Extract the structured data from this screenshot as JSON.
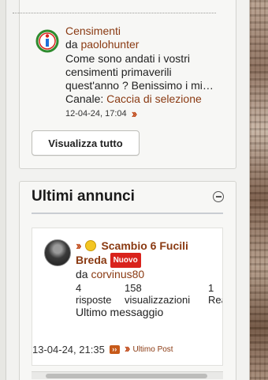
{
  "recent_posts": {
    "item": {
      "title": "Censimenti",
      "by_prefix": "da",
      "author": "paolohunter",
      "excerpt_line1": "Come sono andati i vostri",
      "excerpt_line2": "censimenti primaverili",
      "excerpt_line3": "quest'anno ? Benissimo i mi…",
      "channel_prefix": "Canale:",
      "channel": "Caccia di selezione",
      "timestamp": "12-04-24, 17:04"
    },
    "view_all_label": "Visualizza tutto"
  },
  "ads": {
    "title": "Ultimi annunci",
    "item": {
      "title_line1": "Scambio 6 Fucili",
      "title_line2": "Breda",
      "badge": "Nuovo",
      "by_prefix": "da",
      "author": "corvinus80",
      "replies_count": "4",
      "replies_label": "risposte",
      "views_count": "158",
      "views_label": "visualizzazioni",
      "third_count": "1",
      "third_label": "Rea",
      "last_message_label": "Ultimo messaggio",
      "last_timestamp": "13-04-24, 21:35",
      "last_post_label": "Ultimo Post"
    }
  },
  "colors": {
    "link": "#8a3a12",
    "accent_orange": "#c04a1a",
    "badge_red": "#d9231d"
  },
  "icons": [
    "census-logo-icon",
    "double-chevron-icon",
    "collapse-minus-icon",
    "smiley-icon",
    "avatar",
    "mini-arrow-icon"
  ]
}
